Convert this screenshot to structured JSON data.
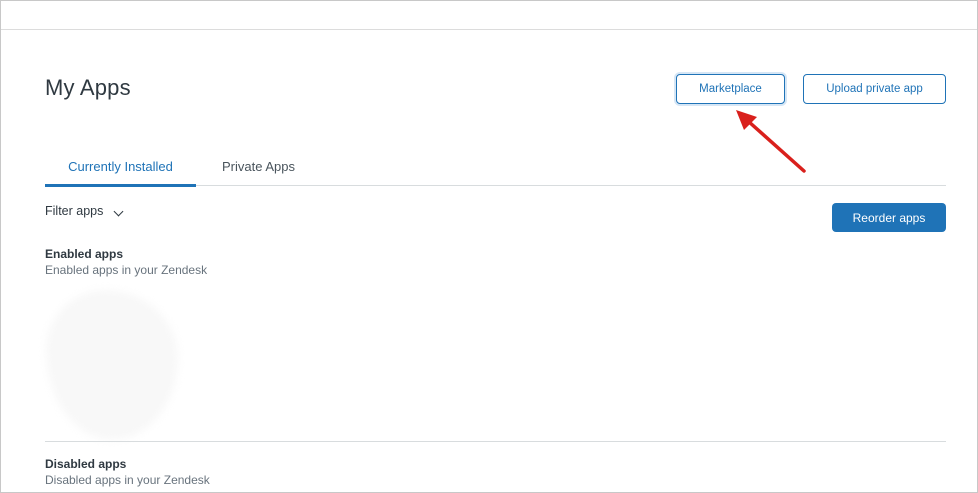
{
  "page": {
    "title": "My Apps"
  },
  "header": {
    "marketplace_label": "Marketplace",
    "upload_label": "Upload private app"
  },
  "tabs": [
    {
      "label": "Currently Installed",
      "active": true
    },
    {
      "label": "Private Apps",
      "active": false
    }
  ],
  "toolbar": {
    "filter_label": "Filter apps",
    "reorder_label": "Reorder apps"
  },
  "sections": {
    "enabled": {
      "heading": "Enabled apps",
      "description": "Enabled apps in your Zendesk"
    },
    "disabled": {
      "heading": "Disabled apps",
      "description": "Disabled apps in your Zendesk"
    }
  },
  "colors": {
    "accent": "#1f73b7",
    "annotation_arrow": "#d9201c",
    "text": "#2f3941",
    "muted_text": "#68737d"
  },
  "icons": {
    "filter_toggle": "chevron-down-icon",
    "annotation": "red-arrow"
  }
}
